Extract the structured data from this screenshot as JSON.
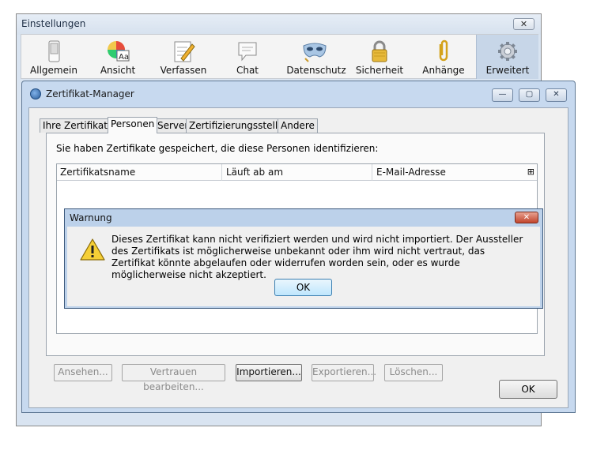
{
  "prefs": {
    "title": "Einstellungen",
    "close_glyph": "✕",
    "panes": [
      {
        "label": "Allgemein",
        "icon": "switch-icon"
      },
      {
        "label": "Ansicht",
        "icon": "color-wheel-icon"
      },
      {
        "label": "Verfassen",
        "icon": "pencil-notepad-icon"
      },
      {
        "label": "Chat",
        "icon": "speech-bubble-icon"
      },
      {
        "label": "Datenschutz",
        "icon": "mask-icon"
      },
      {
        "label": "Sicherheit",
        "icon": "padlock-icon"
      },
      {
        "label": "Anhänge",
        "icon": "paperclip-icon"
      },
      {
        "label": "Erweitert",
        "icon": "gear-icon",
        "active": true
      }
    ]
  },
  "certmgr": {
    "title": "Zertifikat-Manager",
    "window_buttons": {
      "minimize": "—",
      "maximize": "▢",
      "close": "✕"
    },
    "tabs": [
      "Ihre Zertifikate",
      "Personen",
      "Server",
      "Zertifizierungsstellen",
      "Andere"
    ],
    "selected_tab": "Personen",
    "description": "Sie haben Zertifikate gespeichert, die diese Personen identifizieren:",
    "columns": [
      "Zertifikatsname",
      "Läuft ab am",
      "E-Mail-Adresse"
    ],
    "column_picker": "⊞",
    "buttons": {
      "view": "Ansehen...",
      "trust": "Vertrauen bearbeiten...",
      "import": "Importieren...",
      "export": "Exportieren...",
      "delete": "Löschen..."
    },
    "ok": "OK"
  },
  "warning": {
    "title": "Warnung",
    "close_glyph": "✕",
    "message": "Dieses Zertifikat kann nicht verifiziert werden und wird nicht importiert. Der Aussteller des Zertifikats ist möglicherweise unbekannt oder ihm wird nicht vertraut, das Zertifikat könnte abgelaufen oder widerrufen worden sein, oder es wurde möglicherweise nicht akzeptiert.",
    "ok": "OK"
  }
}
